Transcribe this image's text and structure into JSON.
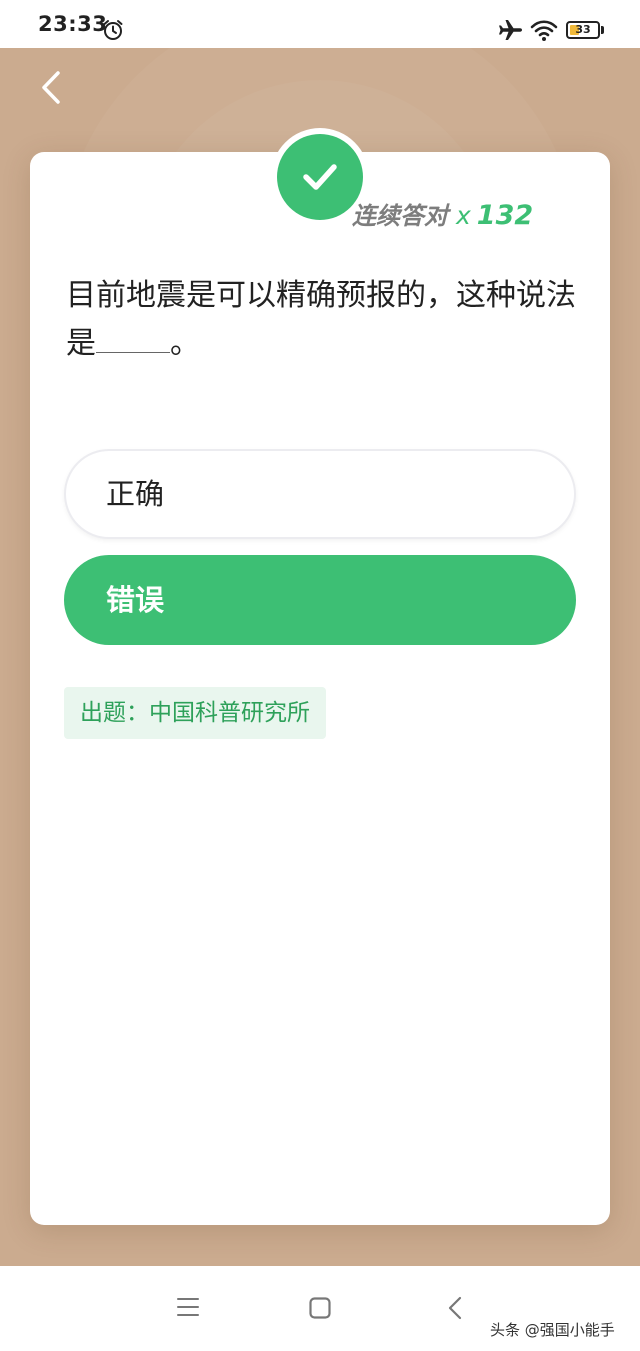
{
  "status_bar": {
    "time": "23:33",
    "battery_level": "33",
    "battery_fraction": 0.33,
    "icons": [
      "alarm-icon",
      "airplane-icon",
      "wifi-icon",
      "battery-icon"
    ]
  },
  "header": {
    "back_icon": "chevron-left-icon"
  },
  "result": {
    "status_icon": "check-icon",
    "streak_label": "连续答对",
    "streak_multiplier": "x",
    "streak_count": "132"
  },
  "question": {
    "text_before_blank": "目前地震是可以精确预报的，这种说法是",
    "text_after_blank": "。"
  },
  "options": [
    {
      "label": "正确",
      "selected": false
    },
    {
      "label": "错误",
      "selected": true
    }
  ],
  "source": {
    "text": "出题：中国科普研究所"
  },
  "nav_bar": {
    "icons": [
      "menu-icon",
      "home-icon",
      "back-icon"
    ]
  },
  "watermark": {
    "text": "头条 @强国小能手"
  },
  "colors": {
    "background": "#cbab8f",
    "accent_green": "#3dbf74",
    "source_text": "#2ea15a",
    "source_bg": "#e9f6ee"
  }
}
